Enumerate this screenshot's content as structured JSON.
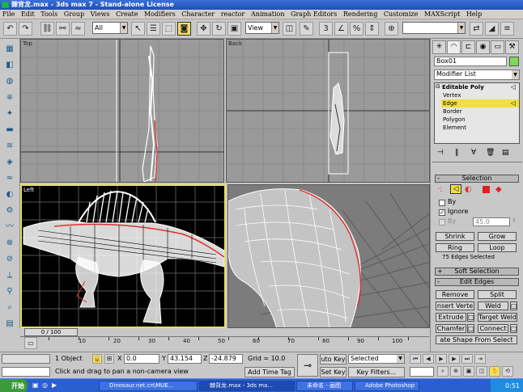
{
  "window": {
    "title": "棘背龙.max - 3ds max 7 - Stand-alone License"
  },
  "menu": [
    "File",
    "Edit",
    "Tools",
    "Group",
    "Views",
    "Create",
    "Modifiers",
    "Character",
    "reactor",
    "Animation",
    "Graph Editors",
    "Rendering",
    "Customize",
    "MAXScript",
    "Help"
  ],
  "toolbar": {
    "selection_filter": "All",
    "ref_coord": "View"
  },
  "viewports": {
    "top": "Top",
    "back": "Back",
    "left": "Left",
    "perspective": ""
  },
  "command_panel": {
    "object_name": "Box01",
    "object_color": "#7ed957",
    "modifier_list": "Modifier List",
    "stack": {
      "root": "Editable Poly",
      "subitems": [
        "Vertex",
        "Edge",
        "Border",
        "Polygon",
        "Element"
      ],
      "selected": "Edge"
    },
    "selection": {
      "title": "Selection",
      "by_vertex": "By",
      "ignore_backfacing": "Ignore",
      "by_angle": "By",
      "angle_value": "45.0",
      "shrink": "Shrink",
      "grow": "Grow",
      "ring": "Ring",
      "loop": "Loop",
      "status": "75 Edges Selected"
    },
    "soft_selection": "Soft Selection",
    "edit_edges": {
      "title": "Edit Edges",
      "remove": "Remove",
      "split": "Split",
      "insert_vertex": "nsert Verte",
      "weld": "Weld",
      "extrude": "Extrude",
      "target_weld": "Target Weld",
      "chamfer": "Chamfer",
      "connect": "Connect",
      "create_shape": "ate Shape From Select"
    }
  },
  "timeline": {
    "frame": "0 / 100",
    "ticks": [
      "10",
      "20",
      "30",
      "40",
      "50",
      "60",
      "70",
      "80",
      "90",
      "100"
    ]
  },
  "status": {
    "selection": "1 Object",
    "x_label": "X",
    "x": "0.0",
    "y_label": "Y",
    "y": "43.154",
    "z_label": "Z",
    "z": "-24.879",
    "grid": "Grid = 10.0",
    "auto_key": "uto Key",
    "set_key": "Set Key",
    "key_mode": "Selected",
    "key_filters": "Key Filters...",
    "prompt": "Click and drag to pan a non-camera view",
    "add_time_tag": "Add Time Tag"
  },
  "taskbar": {
    "start": "开始",
    "tasks": [
      "Dinosaur.net.cn\\MUE...",
      "棘背龙.max - 3ds ma...",
      "未命名 - 画图",
      "Adobe Photoshop"
    ],
    "clock": "0:51"
  }
}
